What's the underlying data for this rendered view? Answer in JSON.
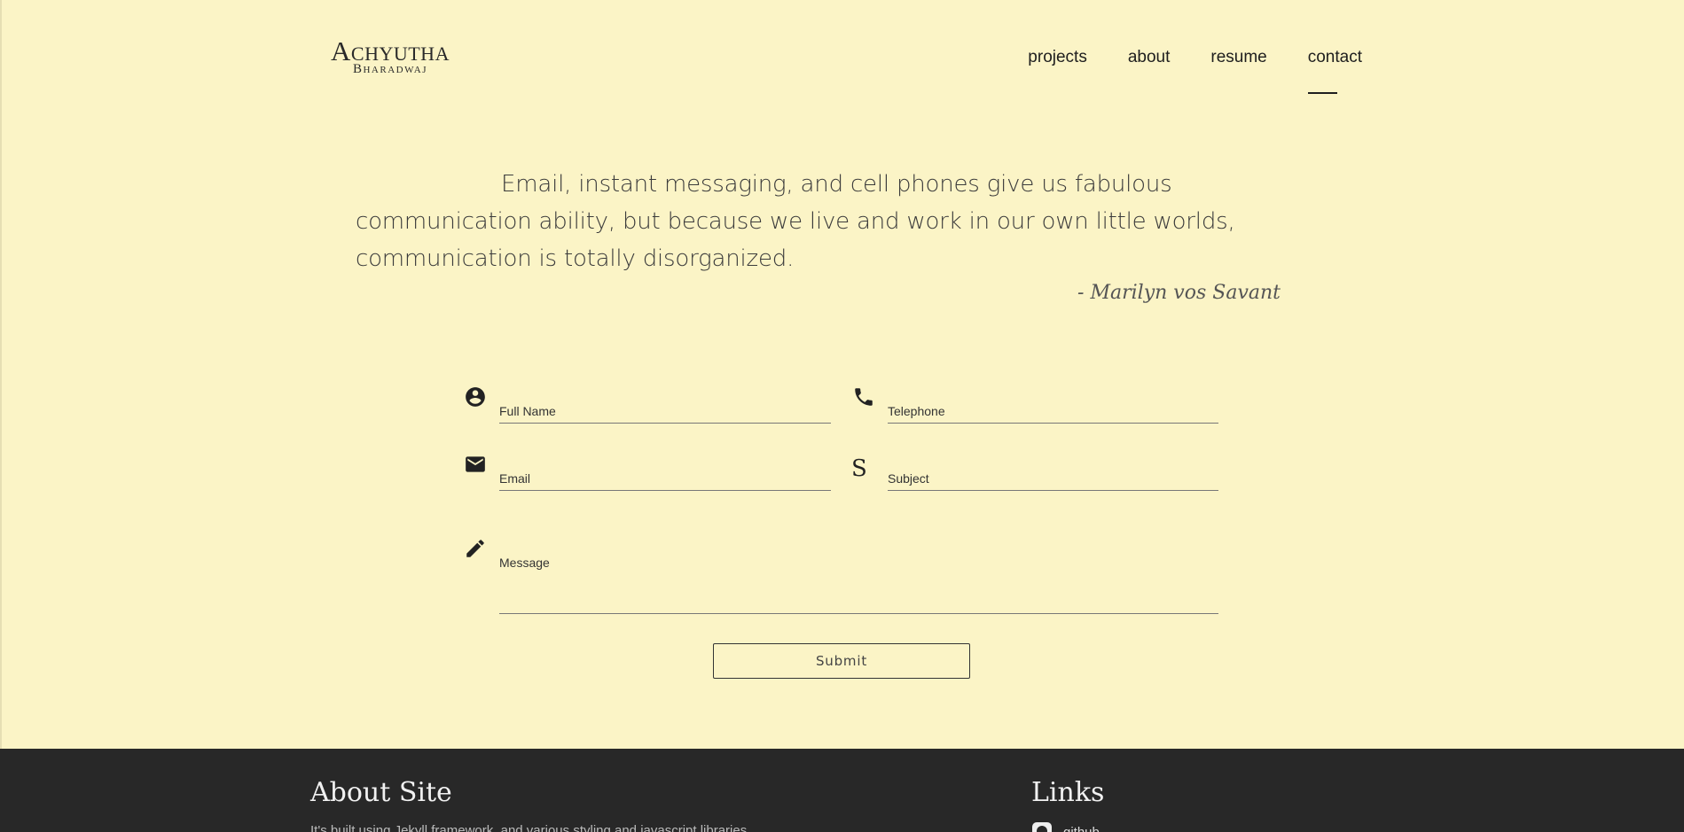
{
  "header": {
    "logo_main": "Achyutha",
    "logo_sub": "Bharadwaj",
    "nav": [
      {
        "label": "projects"
      },
      {
        "label": "about"
      },
      {
        "label": "resume"
      },
      {
        "label": "contact",
        "active": true
      }
    ]
  },
  "quote": {
    "text": "Email, instant messaging, and cell phones give us fabulous communication ability, but because we live and work in our own little worlds, communication is totally disorganized.",
    "author": "- Marilyn vos Savant"
  },
  "form": {
    "full_name_placeholder": "Full Name",
    "telephone_placeholder": "Telephone",
    "email_placeholder": "Email",
    "subject_placeholder": "Subject",
    "subject_icon": "S",
    "message_placeholder": "Message",
    "submit_label": "Submit"
  },
  "footer": {
    "about_heading": "About Site",
    "about_text": "It's built using Jekyll framework, and various styling and javascript libraries.",
    "links_heading": "Links",
    "github_label": "github"
  },
  "colors": {
    "background": "#fbf4c6",
    "footer_bg": "#282828",
    "text": "#2b2b2b"
  }
}
